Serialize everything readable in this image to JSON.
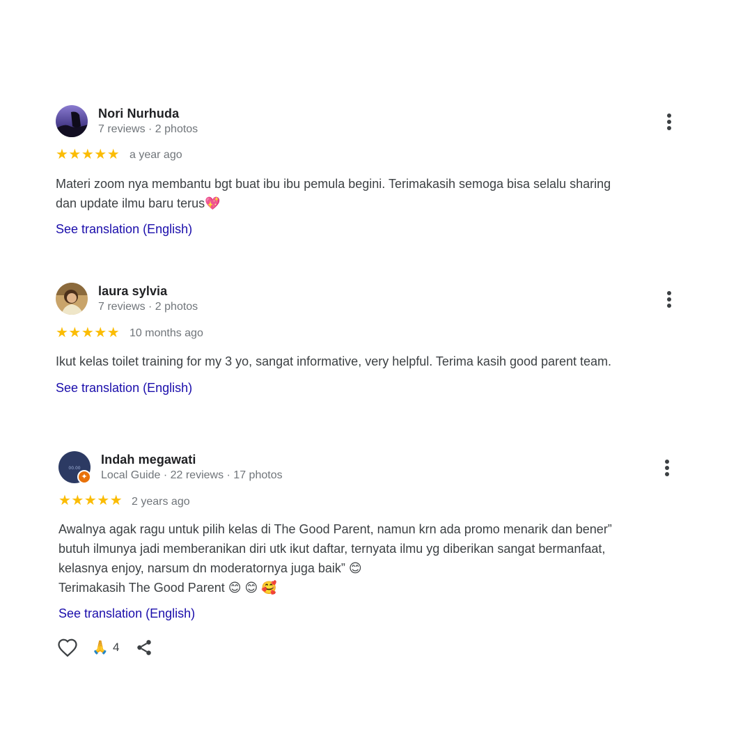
{
  "reviews": [
    {
      "name": "Nori Nurhuda",
      "meta": "7 reviews · 2 photos",
      "stars": "★★★★★",
      "rating": 5,
      "time": "a year ago",
      "text": "Materi zoom nya membantu bgt buat ibu ibu pemula begini. Terimakasih semoga bisa selalu sharing\ndan update ilmu baru terus💖",
      "translate": "See translation (English)",
      "avatar_icon": "profile-photo"
    },
    {
      "name": "laura sylvia",
      "meta": "7 reviews · 2 photos",
      "stars": "★★★★★",
      "rating": 5,
      "time": "10 months ago",
      "text": "Ikut kelas toilet training for my 3 yo, sangat informative, very helpful. Terima kasih good parent team.",
      "translate": "See translation (English)",
      "avatar_icon": "profile-photo"
    },
    {
      "name": "Indah megawati",
      "meta": "Local Guide · 22 reviews · 17 photos",
      "stars": "★★★★★",
      "rating": 5,
      "time": "2 years ago",
      "text": "Awalnya agak ragu untuk pilih kelas di The Good Parent, namun krn ada promo menarik dan bener”\nbutuh ilmunya jadi memberanikan diri utk ikut daftar, ternyata ilmu yg diberikan sangat bermanfaat,\nkelasnya enjoy, narsum dn moderatornya juga baik” 😊\nTerimakasih The Good Parent 😊 😊 🥰",
      "translate": "See translation (English)",
      "avatar_icon": "profile-photo",
      "badge_icon": "local-guide-badge-icon",
      "actions": {
        "like_icon": "heart-icon",
        "reaction_icon": "folded-hands-icon",
        "reaction_emoji": "🙏",
        "reaction_count": "4",
        "share_icon": "share-icon"
      }
    }
  ],
  "colors": {
    "star": "#fbbc04",
    "link": "#1a0dab",
    "name": "#202124",
    "meta": "#70757a",
    "text": "#3c4043",
    "badge": "#e8710a"
  }
}
